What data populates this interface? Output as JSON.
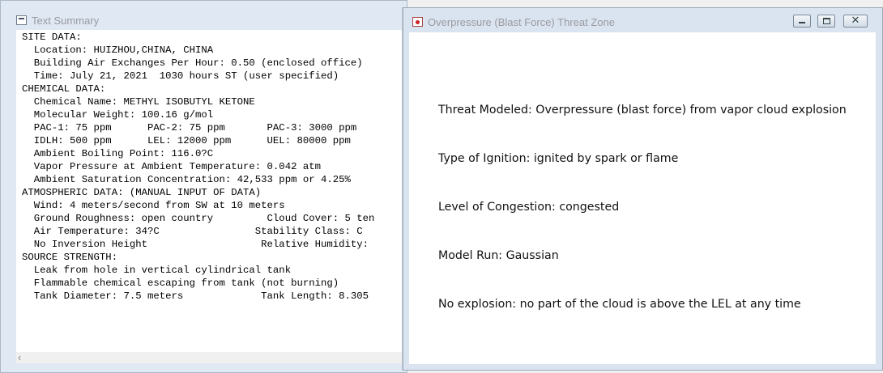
{
  "text_summary": {
    "title": "Text Summary",
    "lines": [
      "SITE DATA:",
      "  Location: HUIZHOU,CHINA, CHINA",
      "  Building Air Exchanges Per Hour: 0.50 (enclosed office)",
      "  Time: July 21, 2021  1030 hours ST (user specified)",
      "",
      "CHEMICAL DATA:",
      "  Chemical Name: METHYL ISOBUTYL KETONE",
      "  Molecular Weight: 100.16 g/mol",
      "  PAC-1: 75 ppm      PAC-2: 75 ppm       PAC-3: 3000 ppm",
      "  IDLH: 500 ppm      LEL: 12000 ppm      UEL: 80000 ppm",
      "  Ambient Boiling Point: 116.0?C",
      "  Vapor Pressure at Ambient Temperature: 0.042 atm",
      "  Ambient Saturation Concentration: 42,533 ppm or 4.25%",
      "",
      "ATMOSPHERIC DATA: (MANUAL INPUT OF DATA)",
      "  Wind: 4 meters/second from SW at 10 meters",
      "  Ground Roughness: open country         Cloud Cover: 5 ten",
      "  Air Temperature: 34?C                Stability Class: C",
      "  No Inversion Height                   Relative Humidity:",
      "",
      "SOURCE STRENGTH:",
      "  Leak from hole in vertical cylindrical tank",
      "  Flammable chemical escaping from tank (not burning)",
      "  Tank Diameter: 7.5 meters             Tank Length: 8.305"
    ],
    "scroll_left_glyph": "‹"
  },
  "threat_window": {
    "title": "Overpressure (Blast Force) Threat Zone",
    "buttons": {
      "minimize": "minimize-icon",
      "maximize": "maximize-icon",
      "close": "✕"
    },
    "lines": [
      "Threat Modeled: Overpressure (blast force) from vapor cloud explosion",
      "Type of Ignition: ignited by spark or flame",
      "Level of Congestion: congested",
      "Model Run: Gaussian",
      "No explosion: no part of the cloud is above the LEL at any time"
    ]
  }
}
